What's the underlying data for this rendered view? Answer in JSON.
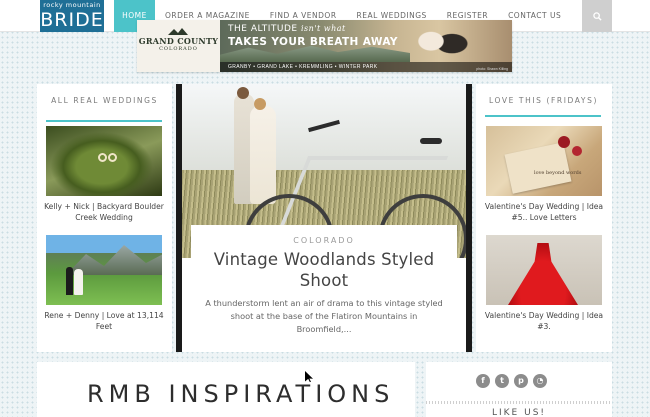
{
  "logo": {
    "top_text": "rocky mountain",
    "main_text": "BRIDE"
  },
  "nav": {
    "items": [
      {
        "label": "HOME",
        "active": true
      },
      {
        "label": "ORDER A MAGAZINE"
      },
      {
        "label": "FIND A VENDOR"
      },
      {
        "label": "REAL WEDDINGS"
      },
      {
        "label": "REGISTER"
      },
      {
        "label": "CONTACT US"
      }
    ],
    "search_icon": "search-icon"
  },
  "banner": {
    "logo_line1": "GRAND COUNTY",
    "logo_line2": "COLORADO",
    "headline1_a": "THE ALTITUDE ",
    "headline1_b": "isn't what",
    "headline2": "TAKES YOUR BREATH AWAY",
    "towns": "GRANBY • GRAND LAKE • KREMMLING • WINTER PARK",
    "credit": "photo: Shawn Killing"
  },
  "left_card": {
    "title": "ALL REAL WEDDINGS",
    "posts": [
      {
        "caption": "Kelly + Nick | Backyard Boulder Creek Wedding"
      },
      {
        "caption": "Rene + Denny | Love at 13,114 Feet"
      }
    ]
  },
  "right_card": {
    "title": "LOVE THIS (FRIDAYS)",
    "posts": [
      {
        "caption": "Valentine's Day Wedding | Idea #5.. Love Letters",
        "thumb_text": "love beyond words"
      },
      {
        "caption": "Valentine's Day Wedding | Idea #3."
      }
    ]
  },
  "feature": {
    "category": "COLORADO",
    "title": "Vintage Woodlands Styled Shoot",
    "excerpt": "A thunderstorm lent an air of drama to this vintage styled shoot at the base of the Flatiron Mountains in Broomfield,..."
  },
  "bottom": {
    "inspirations_title": "RMB INSPIRATIONS",
    "socials": [
      "facebook-icon",
      "twitter-icon",
      "pinterest-icon",
      "rss-icon"
    ],
    "like_us": "LIKE US!"
  },
  "colors": {
    "accent": "#4cc3c9",
    "logo_bg": "#1f6f96"
  }
}
